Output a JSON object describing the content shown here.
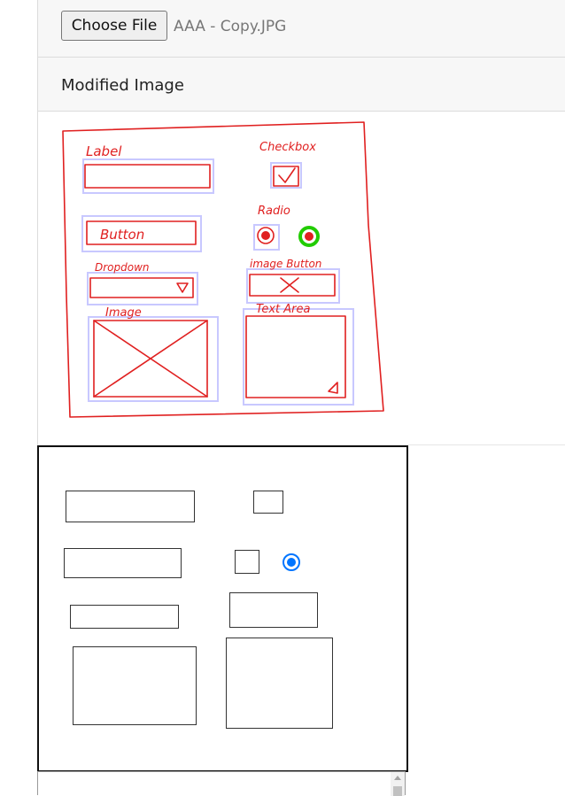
{
  "upload": {
    "button_label": "Choose File",
    "file_name": "AAA - Copy.JPG"
  },
  "modified_card": {
    "title": "Modified Image"
  },
  "sketch": {
    "labels": {
      "label": "Label",
      "checkbox": "Checkbox",
      "radio": "Radio",
      "button": "Button",
      "dropdown": "Dropdown",
      "image_button": "image Button",
      "image": "Image",
      "text_area": "Text Area"
    },
    "colors": {
      "ink": "#e02020",
      "detection_box": "#c8c8ff",
      "radio_highlight": "#22cc00"
    }
  },
  "generated_form": {
    "radio_selected": true,
    "accent_color": "#0075ff"
  }
}
